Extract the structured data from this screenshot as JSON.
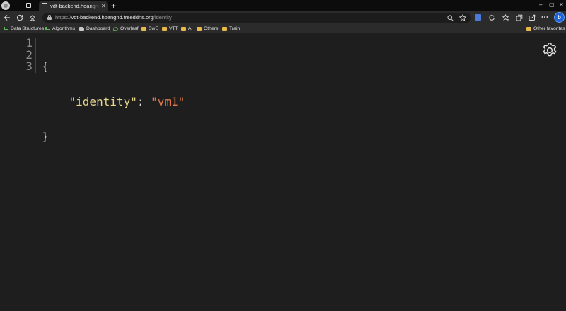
{
  "browser": {
    "tab": {
      "title": "vdt-backend.hoangnd.freeddns.org/identity",
      "close_glyph": "✕"
    },
    "new_tab_glyph": "+",
    "window": {
      "minimize": "–",
      "maximize": "▢",
      "close": "✕"
    }
  },
  "address_bar": {
    "scheme": "https://",
    "host": "vdt-backend.hoangnd.freeddns.org",
    "path": "/identity"
  },
  "bookmarks": [
    {
      "label": "Data Structures",
      "icon": "leetcode-icon"
    },
    {
      "label": "Algorithms",
      "icon": "leetcode-icon"
    },
    {
      "label": "Dashboard",
      "icon": "dashboard-icon"
    },
    {
      "label": "Overleaf",
      "icon": "overleaf-icon"
    },
    {
      "label": "SwE",
      "icon": "folder-icon"
    },
    {
      "label": "VTT",
      "icon": "folder-icon"
    },
    {
      "label": "AI",
      "icon": "folder-icon"
    },
    {
      "label": "Others",
      "icon": "folder-icon"
    },
    {
      "label": "Train",
      "icon": "folder-icon"
    }
  ],
  "other_favorites": {
    "label": "Other favorites",
    "icon": "folder-icon"
  },
  "json_viewer": {
    "line_numbers": [
      "1",
      "2",
      "3"
    ],
    "open_brace": "{",
    "key": "\"identity\"",
    "colon": ": ",
    "value": "\"vm1\"",
    "close_brace": "}"
  },
  "colors": {
    "page_bg": "#1e1e1f",
    "json_key": "#e6d58c",
    "json_string": "#e07a4b",
    "accent": "#1f63d6"
  }
}
